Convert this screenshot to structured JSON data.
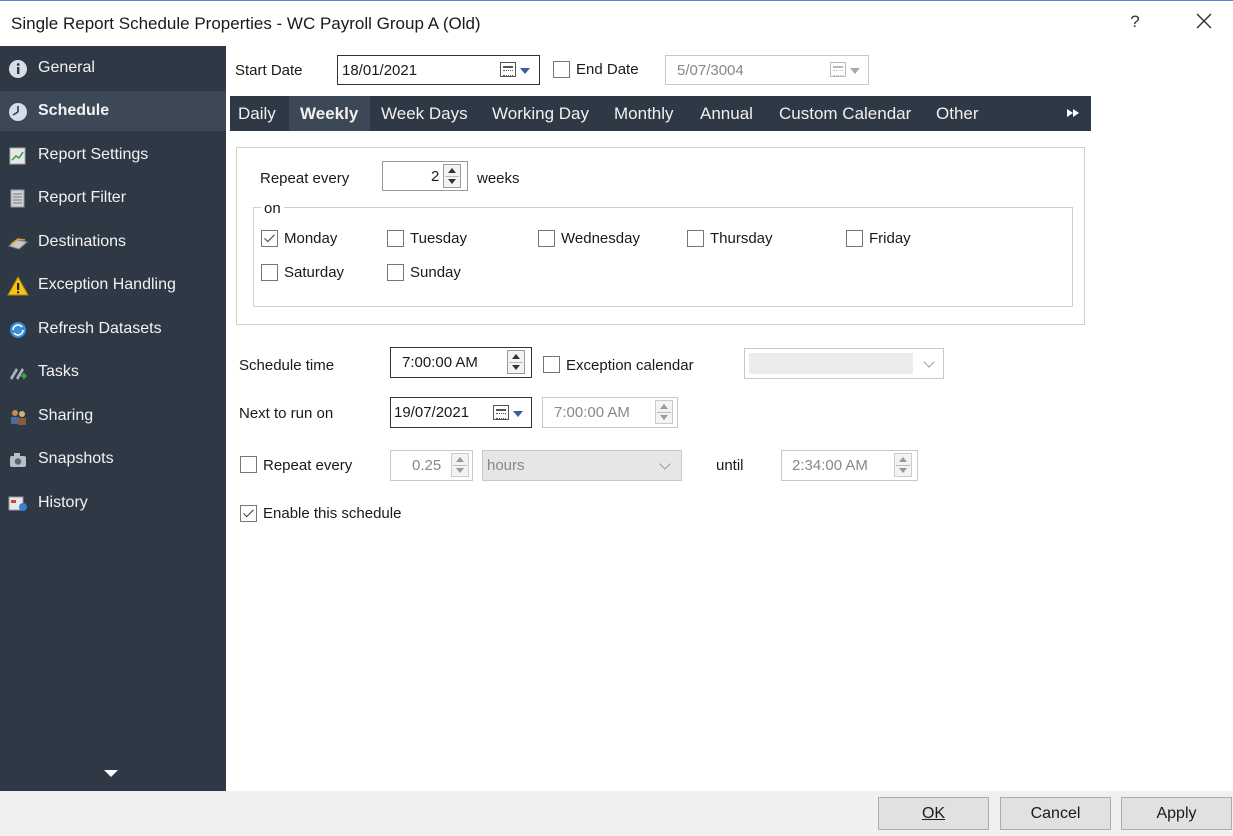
{
  "window": {
    "title": "Single Report Schedule Properties - WC Payroll Group A (Old)",
    "help_glyph": "?"
  },
  "sidebar": {
    "items": [
      {
        "label": "General",
        "icon": "info-icon"
      },
      {
        "label": "Schedule",
        "icon": "clock-icon",
        "active": true
      },
      {
        "label": "Report Settings",
        "icon": "report-settings-icon"
      },
      {
        "label": "Report Filter",
        "icon": "report-filter-icon"
      },
      {
        "label": "Destinations",
        "icon": "destinations-icon"
      },
      {
        "label": "Exception Handling",
        "icon": "warning-icon"
      },
      {
        "label": "Refresh Datasets",
        "icon": "refresh-icon"
      },
      {
        "label": "Tasks",
        "icon": "tasks-icon"
      },
      {
        "label": "Sharing",
        "icon": "sharing-icon"
      },
      {
        "label": "Snapshots",
        "icon": "snapshots-icon"
      },
      {
        "label": "History",
        "icon": "history-icon"
      }
    ]
  },
  "dates": {
    "start_label": "Start Date",
    "start_value": "18/01/2021",
    "end_label": "End Date",
    "end_checked": false,
    "end_value": "5/07/3004"
  },
  "tabs": [
    {
      "label": "Daily"
    },
    {
      "label": "Weekly",
      "active": true
    },
    {
      "label": "Week Days"
    },
    {
      "label": "Working Day"
    },
    {
      "label": "Monthly"
    },
    {
      "label": "Annual"
    },
    {
      "label": "Custom Calendar"
    },
    {
      "label": "Other"
    }
  ],
  "weekly": {
    "repeat_label": "Repeat every",
    "repeat_value": "2",
    "repeat_unit": "weeks",
    "on_label": "on",
    "days": [
      {
        "label": "Monday",
        "checked": true
      },
      {
        "label": "Tuesday",
        "checked": false
      },
      {
        "label": "Wednesday",
        "checked": false
      },
      {
        "label": "Thursday",
        "checked": false
      },
      {
        "label": "Friday",
        "checked": false
      },
      {
        "label": "Saturday",
        "checked": false
      },
      {
        "label": "Sunday",
        "checked": false
      }
    ]
  },
  "schedule": {
    "time_label": "Schedule time",
    "time_value": "7:00:00 AM",
    "exception_label": "Exception calendar",
    "exception_checked": false,
    "exception_value": "",
    "next_label": "Next to run on",
    "next_date": "19/07/2021",
    "next_time": "7:00:00 AM",
    "repeat_label": "Repeat every",
    "repeat_checked": false,
    "repeat_value": "0.25",
    "repeat_unit": "hours",
    "until_label": "until",
    "until_value": "2:34:00 AM",
    "enable_label": "Enable this schedule",
    "enable_checked": true
  },
  "buttons": {
    "ok": "OK",
    "cancel": "Cancel",
    "apply": "Apply"
  }
}
